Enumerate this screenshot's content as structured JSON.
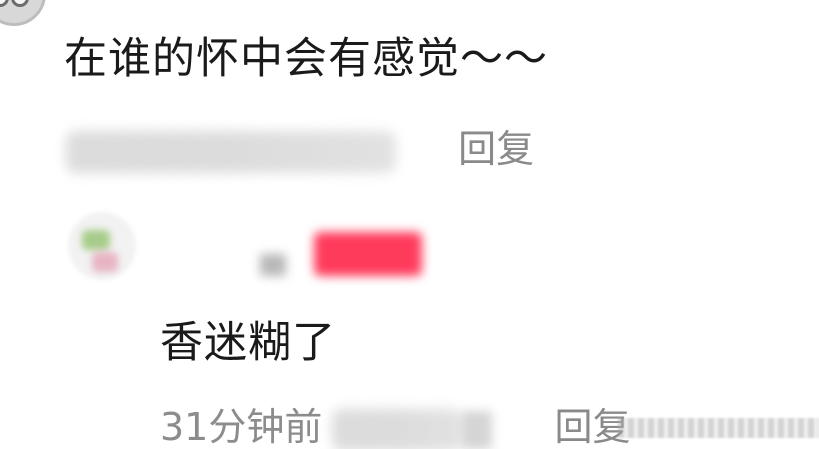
{
  "comments": [
    {
      "text": "在谁的怀中会有感觉～～",
      "time_visible": "",
      "reply_label": "回复"
    },
    {
      "text": "香迷糊了",
      "time_visible": "31分钟前",
      "reply_label": "回复"
    }
  ],
  "colors": {
    "text": "#1a1a1a",
    "meta": "#8c8c8c",
    "username_highlight": "#ff3b5c"
  },
  "icons": [
    "avatar-icon"
  ]
}
